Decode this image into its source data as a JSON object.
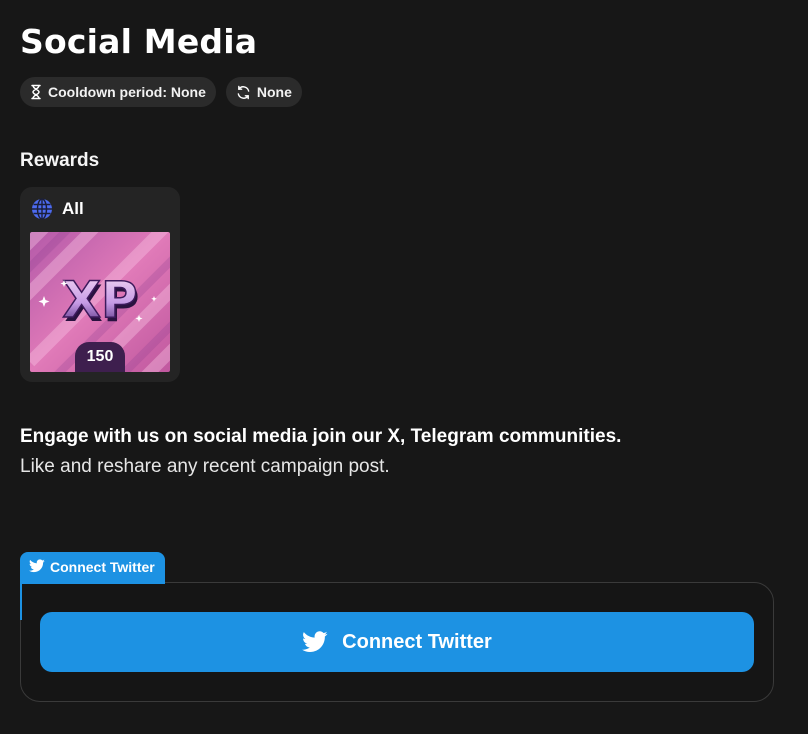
{
  "page": {
    "title": "Social Media"
  },
  "chips": {
    "cooldown": {
      "label": "Cooldown period: None",
      "icon": "hourglass-icon"
    },
    "recurrence": {
      "label": "None",
      "icon": "refresh-icon"
    }
  },
  "rewards": {
    "heading": "Rewards",
    "card": {
      "scope_label": "All",
      "scope_icon": "globe-icon",
      "image_text": "XP",
      "amount": "150"
    }
  },
  "description": {
    "primary": "Engage with us on social media join our X, Telegram communities.",
    "secondary": "Like and reshare any recent campaign post."
  },
  "connect": {
    "tab_label": "Connect Twitter",
    "button_label": "Connect Twitter",
    "icon": "twitter-icon"
  },
  "colors": {
    "background": "#171717",
    "accent": "#1d92e3",
    "chip_bg": "#2b2b2b",
    "card_bg": "#242424",
    "badge_bg": "#3e1f4e"
  }
}
